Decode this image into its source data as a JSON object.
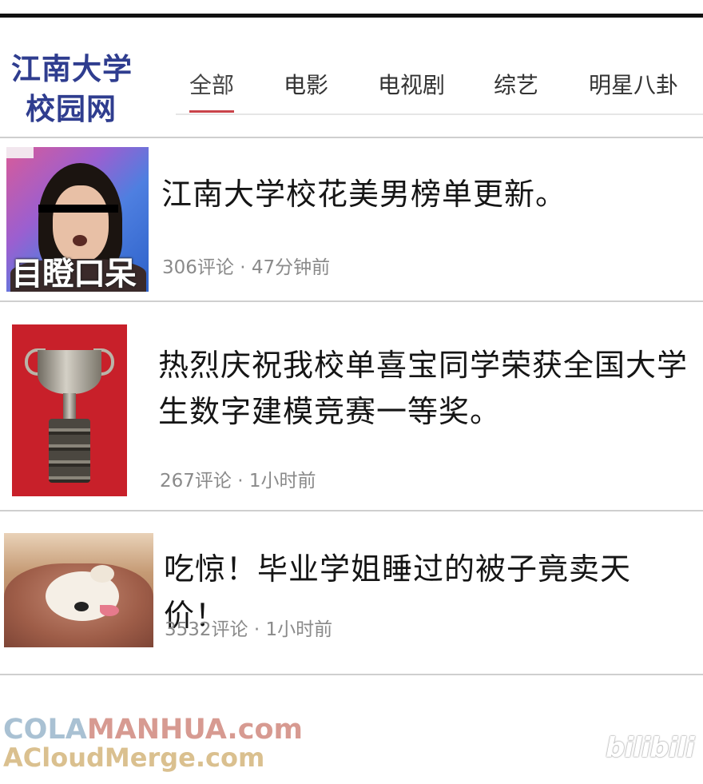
{
  "header": {
    "logo_line1": "江南大学",
    "logo_line2": "校园网",
    "tabs": [
      {
        "label": "全部",
        "active": true
      },
      {
        "label": "电影",
        "active": false
      },
      {
        "label": "电视剧",
        "active": false
      },
      {
        "label": "综艺",
        "active": false
      },
      {
        "label": "明星八卦",
        "active": false
      }
    ],
    "accent_color": "#c9444a",
    "logo_color": "#2f3d8f"
  },
  "articles": [
    {
      "title": "江南大学校花美男榜单更新。",
      "meta": "306评论 · 47分钟前",
      "thumb_caption": "目瞪口呆",
      "thumb_icon": "tv-screenshot-woman"
    },
    {
      "title": "热烈庆祝我校单喜宝同学荣获全国大学生数字建模竞赛一等奖。",
      "meta": "267评论 · 1小时前",
      "thumb_icon": "trophy-cup"
    },
    {
      "title": "吃惊！毕业学姐睡过的被子竟卖天价！",
      "meta": "3532评论 · 1小时前",
      "thumb_icon": "sleeping-puppy"
    }
  ],
  "watermark": {
    "line1_a": "COLA",
    "line1_b": "MANHUA.com",
    "line2": "ACloudMerge.com",
    "brand": "bilibili"
  }
}
